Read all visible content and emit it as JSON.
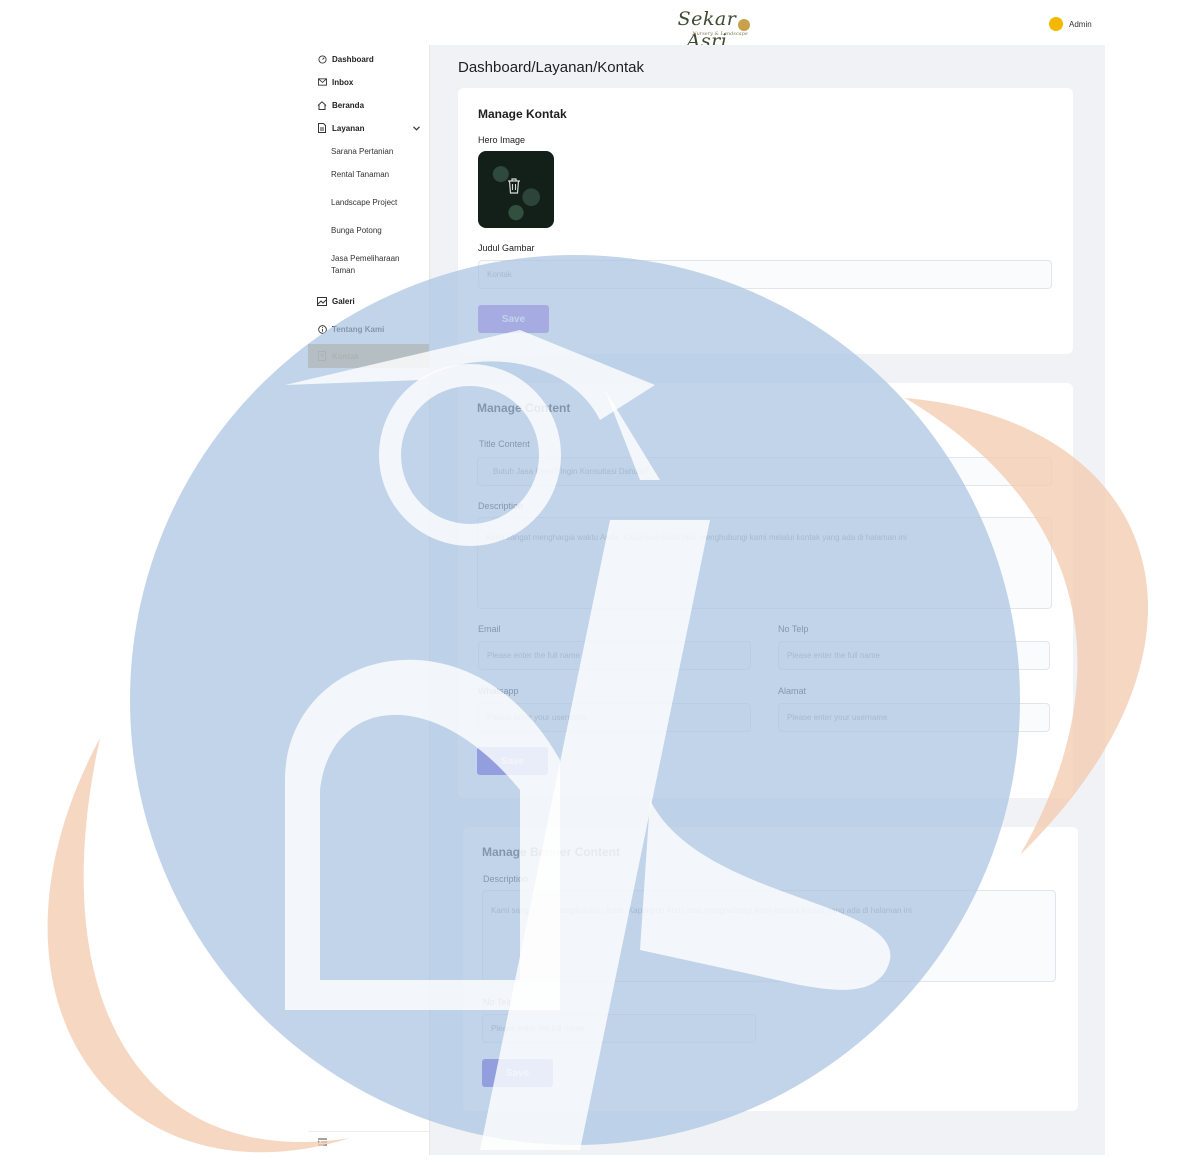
{
  "header": {
    "logo_text": "Sekar Asri",
    "logo_subtitle": "Nursery & Landscape",
    "user_name": "Admin",
    "avatar_color": "#f5b800"
  },
  "sidebar": {
    "items": [
      {
        "label": "Dashboard",
        "icon": "gauge-icon"
      },
      {
        "label": "Inbox",
        "icon": "mail-icon"
      },
      {
        "label": "Beranda",
        "icon": "home-icon"
      },
      {
        "label": "Layanan",
        "icon": "document-icon"
      },
      {
        "label": "Galeri",
        "icon": "gallery-icon"
      },
      {
        "label": "Tentang Kami",
        "icon": "info-icon"
      },
      {
        "label": "Kontak",
        "icon": "contact-icon",
        "active": true
      }
    ],
    "layanan_sub": [
      "Sarana Pertanian",
      "Rental Tanaman",
      "Landscape Project",
      "Bunga Potong",
      "Jasa Pemeliharaan Taman"
    ],
    "active_color": "#d4b372",
    "collapse_icon": "menu-collapse-icon"
  },
  "main": {
    "breadcrumb": "Dashboard/Layanan/Kontak",
    "kontak": {
      "title": "Manage Kontak",
      "hero_label": "Hero Image",
      "judul_label": "Judul Gambar",
      "judul_value": "Kontak",
      "save": "Save"
    },
    "content": {
      "title": "Manage Content",
      "title_label": "Title Content",
      "title_value": "Butuh Jasa Kami? Ingin Konsultasi Dahulu?",
      "desc_label": "Description",
      "desc_value": "Kami sangat menghargai waktu Anda. Kapanpun Anda bisa menghubungi kami melalui kontak yang ada di halaman ini",
      "email_label": "Email",
      "email_placeholder": "Please enter the full name",
      "telp_label": "No Telp",
      "telp_placeholder": "Please enter the full name",
      "wa_label": "Whatsapp",
      "wa_placeholder": "Please enter your username",
      "alamat_label": "Alamat",
      "alamat_placeholder": "Please enter your username",
      "save": "Save"
    },
    "banner": {
      "title": "Manage Banner Content",
      "desc_label": "Description",
      "desc_value": "Kami sangat menghargai waktu Anda. Kapanpun Anda bisa menghubungi kami melalui kontak yang ada di halaman ini",
      "telp_label": "No Telp",
      "telp_placeholder": "Please enter the full name",
      "save": "Save"
    },
    "colors": {
      "save_light": "#9d6ce3",
      "save_dark": "#5b3fd4",
      "page_bg": "#f1f2f6"
    }
  }
}
